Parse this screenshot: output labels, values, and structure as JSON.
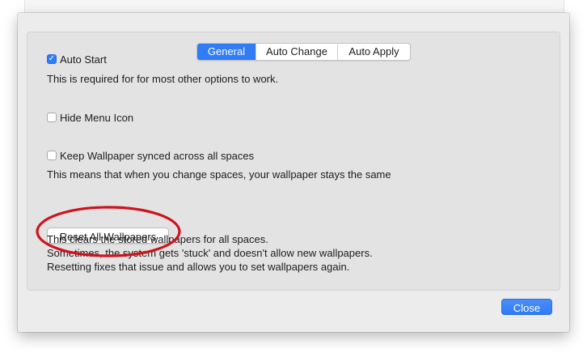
{
  "tabs": [
    {
      "label": "General",
      "active": true
    },
    {
      "label": "Auto Change",
      "active": false
    },
    {
      "label": "Auto Apply",
      "active": false
    }
  ],
  "general": {
    "auto_start": {
      "label": "Auto Start",
      "checked": true
    },
    "auto_start_note": "This is required for for most other options to work.",
    "hide_menu_icon": {
      "label": "Hide Menu Icon",
      "checked": false
    },
    "keep_synced": {
      "label": "Keep Wallpaper synced across all spaces",
      "checked": false
    },
    "keep_synced_note": "This means that when you change spaces, your wallpaper stays the same",
    "reset_button_label": "Reset All Wallpapers",
    "reset_notes": [
      "This clears the stored wallpapers for all spaces.",
      "Sometimes, the system gets 'stuck' and doesn't allow new wallpapers.",
      "Resetting fixes that issue and allows you to set wallpapers again."
    ]
  },
  "footer": {
    "close_label": "Close"
  },
  "colors": {
    "accent": "#2f7cf6",
    "annotation": "#d0121b",
    "window_bg": "#ececec",
    "panel_bg": "#e3e3e3"
  },
  "icons": {
    "checkmark": "checkmark-icon"
  }
}
